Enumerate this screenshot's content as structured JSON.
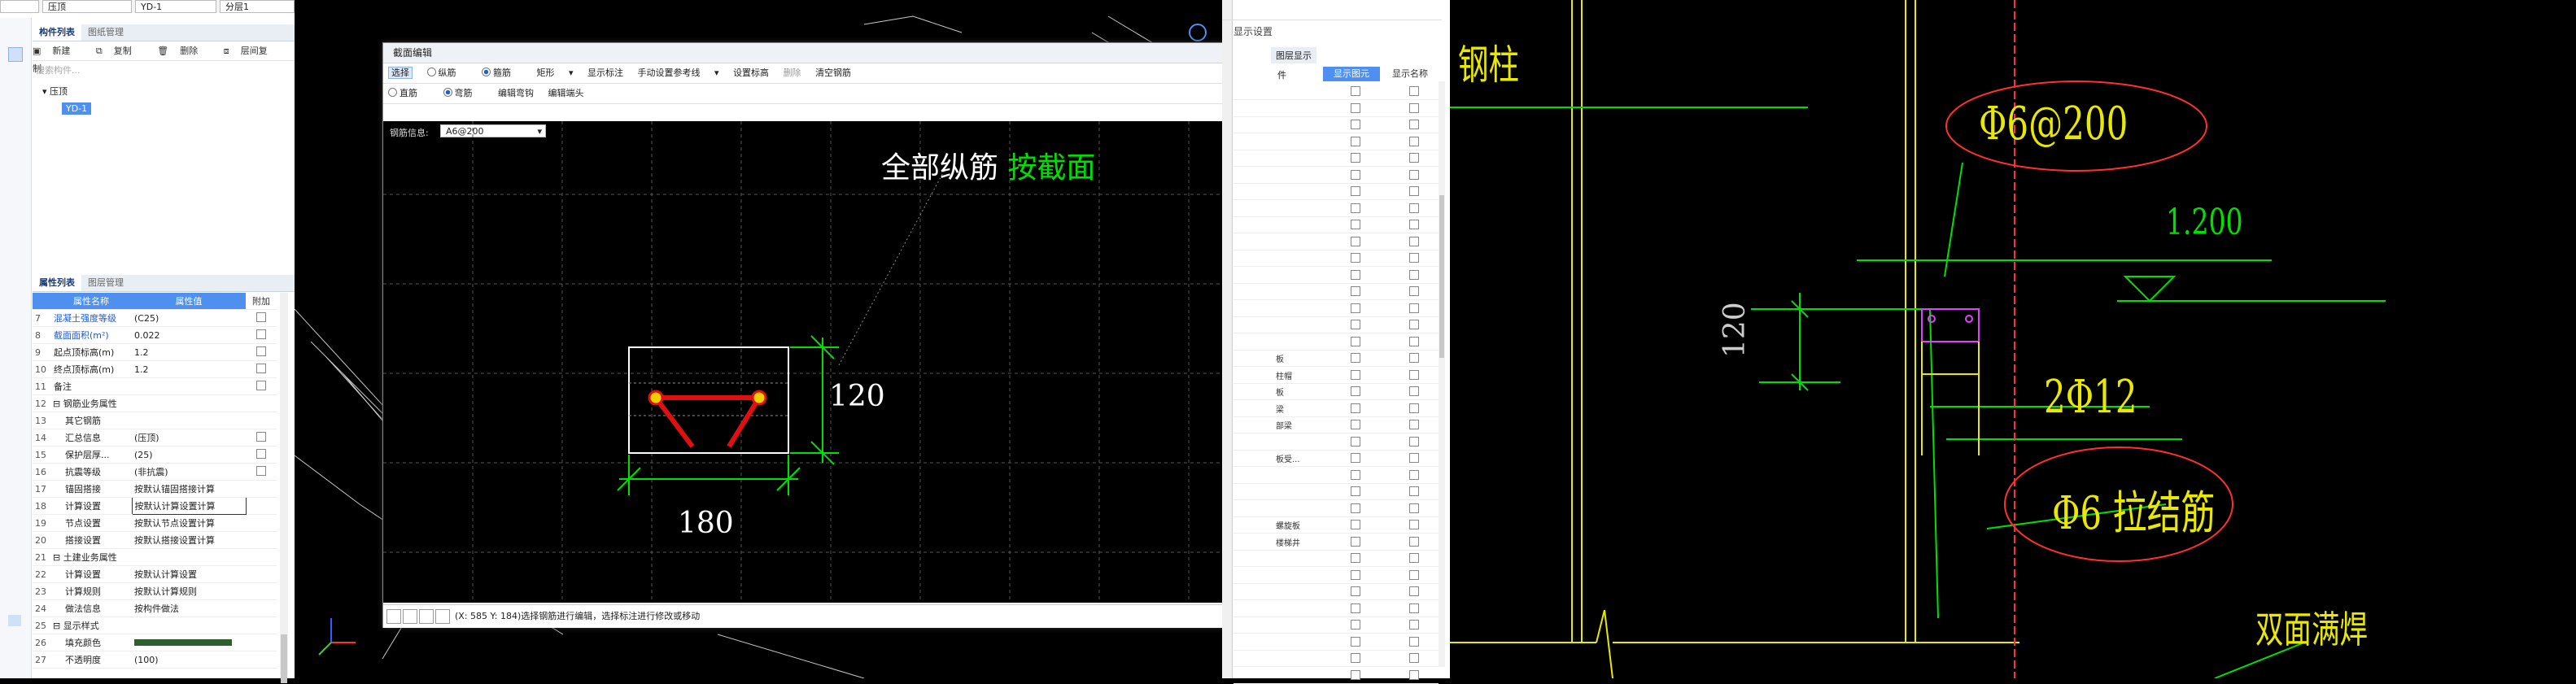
{
  "left_panel": {
    "dropdowns": [
      "压顶",
      "YD-1",
      "分层1"
    ],
    "component_tabs": [
      "构件列表",
      "图纸管理"
    ],
    "toolbar": [
      "新建",
      "复制",
      "删除",
      "层间复制"
    ],
    "search_placeholder": "搜索构件...",
    "tree_root": "压顶",
    "tree_child": "YD-1",
    "prop_tabs": [
      "属性列表",
      "图层管理"
    ],
    "prop_headers": [
      "属性名称",
      "属性值",
      "附加"
    ],
    "props": [
      {
        "no": "7",
        "name": "混凝土强度等级",
        "value": "(C25)",
        "check": true
      },
      {
        "no": "8",
        "name": "截面面积(m²)",
        "value": "0.022",
        "check": true
      },
      {
        "no": "9",
        "name": "起点顶标高(m)",
        "value": "1.2",
        "check": true
      },
      {
        "no": "10",
        "name": "终点顶标高(m)",
        "value": "1.2",
        "check": true
      },
      {
        "no": "11",
        "name": "备注",
        "value": "",
        "check": true
      },
      {
        "no": "12",
        "name": "钢筋业务属性",
        "value": "",
        "check": false
      },
      {
        "no": "13",
        "name": "其它钢筋",
        "value": "",
        "check": false
      },
      {
        "no": "14",
        "name": "汇总信息",
        "value": "(压顶)",
        "check": true
      },
      {
        "no": "15",
        "name": "保护层厚...",
        "value": "(25)",
        "check": true
      },
      {
        "no": "16",
        "name": "抗震等级",
        "value": "(非抗震)",
        "check": true
      },
      {
        "no": "17",
        "name": "锚固搭接",
        "value": "按默认锚固搭接计算",
        "check": false
      },
      {
        "no": "18",
        "name": "计算设置",
        "value": "按默认计算设置计算",
        "check": false
      },
      {
        "no": "19",
        "name": "节点设置",
        "value": "按默认节点设置计算",
        "check": false
      },
      {
        "no": "20",
        "name": "搭接设置",
        "value": "按默认搭接设置计算",
        "check": false
      },
      {
        "no": "21",
        "name": "土建业务属性",
        "value": "",
        "check": false
      },
      {
        "no": "22",
        "name": "计算设置",
        "value": "按默认计算设置",
        "check": false
      },
      {
        "no": "23",
        "name": "计算规则",
        "value": "按默认计算规则",
        "check": false
      },
      {
        "no": "24",
        "name": "做法信息",
        "value": "按构件做法",
        "check": false
      },
      {
        "no": "25",
        "name": "显示样式",
        "value": "",
        "check": false
      },
      {
        "no": "26",
        "name": "填充颜色",
        "value": "",
        "check": false
      },
      {
        "no": "27",
        "name": "不透明度",
        "value": "(100)",
        "check": false
      }
    ]
  },
  "dialog": {
    "title": "截面编辑",
    "close": "×",
    "toolbar1": [
      "选择",
      "纵筋",
      "箍筋",
      "矩形",
      "显示标注",
      "手动设置参考线",
      "设置标高",
      "删除",
      "清空钢筋"
    ],
    "toolbar2": [
      "直筋",
      "弯筋",
      "编辑弯钩",
      "编辑端头"
    ],
    "rebar_label": "钢筋信息:",
    "rebar_value": "A6@200",
    "annotation_white": "全部纵筋",
    "annotation_green": "按截面",
    "dim_height": "120",
    "dim_width": "180",
    "status_text": "(X: 585 Y: 184)选择钢筋进行编辑，选择标注进行修改或移动"
  },
  "right_panel": {
    "title": "显示设置",
    "tabs": [
      "图层显示"
    ],
    "headers": [
      "显示图元",
      "显示名称"
    ],
    "partial_labels": [
      "件",
      "",
      "",
      "",
      "",
      "",
      "",
      "",
      "",
      "",
      "",
      "",
      "",
      "",
      "",
      "",
      "",
      "",
      "",
      "",
      "",
      "",
      "",
      "",
      "",
      "",
      "",
      "",
      "",
      "",
      "",
      "",
      "",
      "",
      "",
      "",
      "",
      "",
      "",
      ""
    ],
    "row_count": 36,
    "side_labels": [
      "板",
      "柱帽",
      "板",
      "梁",
      "部梁",
      "",
      "板受...",
      "",
      "",
      "",
      "螺旋板",
      "楼梯井"
    ]
  },
  "drawing": {
    "label_gangzhu": "钢柱",
    "label_rebar1": "Φ6@200",
    "label_elev": "1.200",
    "label_120": "120",
    "label_rebar2": "2Φ12",
    "label_tie": "Φ6 拉结筋",
    "label_weld": "双面满焊"
  },
  "colors": {
    "accent": "#4f8ff0",
    "cad_green": "#00e000",
    "cad_yellow": "#e8e800",
    "cad_red": "#ff3030"
  }
}
